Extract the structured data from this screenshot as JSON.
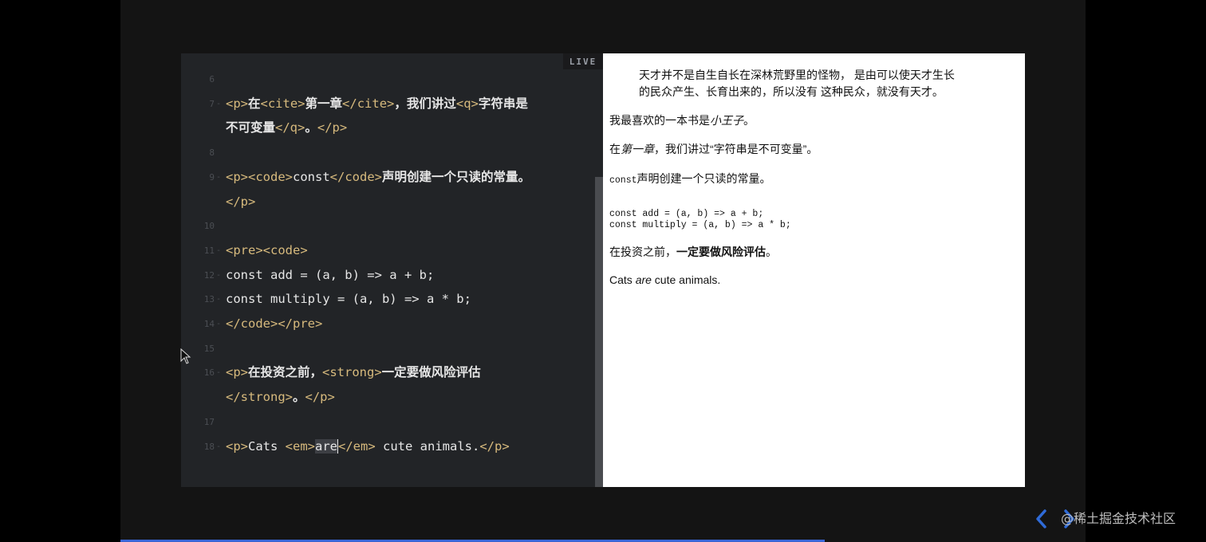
{
  "editor": {
    "live_label": "LIVE",
    "lines": [
      {
        "n": "6"
      },
      {
        "n": "7",
        "parts": [
          [
            "tag",
            "<p>"
          ],
          [
            "cjk",
            "在"
          ],
          [
            "tag",
            "<cite>"
          ],
          [
            "cjk",
            "第一章"
          ],
          [
            "tag",
            "</cite>"
          ],
          [
            "cjk",
            "，我们讲过"
          ],
          [
            "tag",
            "<q>"
          ],
          [
            "cjk",
            "字符串是"
          ]
        ]
      },
      {
        "n": "",
        "parts": [
          [
            "cjk",
            "不可变量"
          ],
          [
            "tag",
            "</q>"
          ],
          [
            "cjk",
            "。"
          ],
          [
            "tag",
            "</p>"
          ]
        ]
      },
      {
        "n": "8"
      },
      {
        "n": "9",
        "parts": [
          [
            "tag",
            "<p><code>"
          ],
          [
            "plain",
            "const"
          ],
          [
            "tag",
            "</code>"
          ],
          [
            "cjk",
            "声明创建一个只读的常量。"
          ]
        ]
      },
      {
        "n": "",
        "parts": [
          [
            "tag",
            "</p>"
          ]
        ]
      },
      {
        "n": "10"
      },
      {
        "n": "11",
        "parts": [
          [
            "tag",
            "<pre><code>"
          ]
        ]
      },
      {
        "n": "12",
        "parts": [
          [
            "plain",
            "const add = (a, b) => a + b;"
          ]
        ]
      },
      {
        "n": "13",
        "parts": [
          [
            "plain",
            "const multiply = (a, b) => a * b;"
          ]
        ]
      },
      {
        "n": "14",
        "parts": [
          [
            "tag",
            "</code></pre>"
          ]
        ]
      },
      {
        "n": "15"
      },
      {
        "n": "16",
        "parts": [
          [
            "tag",
            "<p>"
          ],
          [
            "cjk",
            "在投资之前，"
          ],
          [
            "tag",
            "<strong>"
          ],
          [
            "cjk",
            "一定要做风险评估"
          ]
        ]
      },
      {
        "n": "",
        "parts": [
          [
            "tag",
            "</strong>"
          ],
          [
            "cjk",
            "。"
          ],
          [
            "tag",
            "</p>"
          ]
        ]
      },
      {
        "n": "17"
      },
      {
        "n": "18",
        "parts": [
          [
            "tag",
            "<p>"
          ],
          [
            "plain",
            "Cats "
          ],
          [
            "tag",
            "<em>"
          ],
          [
            "sel",
            "are"
          ],
          [
            "tag",
            "</em>"
          ],
          [
            "plain",
            " cute animals."
          ],
          [
            "tag",
            "</p>"
          ]
        ]
      }
    ]
  },
  "preview": {
    "quote_line1": "天才并不是自生自长在深林荒野里的怪物， 是由可以使天才生长",
    "quote_line2": "的民众产生、长育出来的，所以没有 这种民众，就没有天才。",
    "book_prefix": "我最喜欢的一本书是",
    "book_title": "小王子",
    "book_suffix": "。",
    "chapter_prefix": "在",
    "chapter_cite": "第一章",
    "chapter_mid": "，我们讲过",
    "chapter_quote": "“字符串是不可变量”",
    "chapter_suffix": "。",
    "const_code": "const",
    "const_text": "声明创建一个只读的常量。",
    "pre_line1": "const add = (a, b) => a + b;",
    "pre_line2": "const multiply = (a, b) => a * b;",
    "invest_prefix": "在投资之前，",
    "invest_strong": "一定要做风险评估",
    "invest_suffix": "。",
    "cats_prefix": "Cats ",
    "cats_em": "are",
    "cats_suffix": " cute animals."
  },
  "watermark": "@稀土掘金技术社区",
  "colors": {
    "tag": "#d7ba7d",
    "code_text": "#e6e6e6",
    "nav_arrow": "#2f6bd8",
    "progress": "#3a66d6"
  },
  "icons": {
    "mouse": "arrow-pointer-icon",
    "prev": "chevron-left-icon",
    "next": "chevron-right-icon"
  }
}
